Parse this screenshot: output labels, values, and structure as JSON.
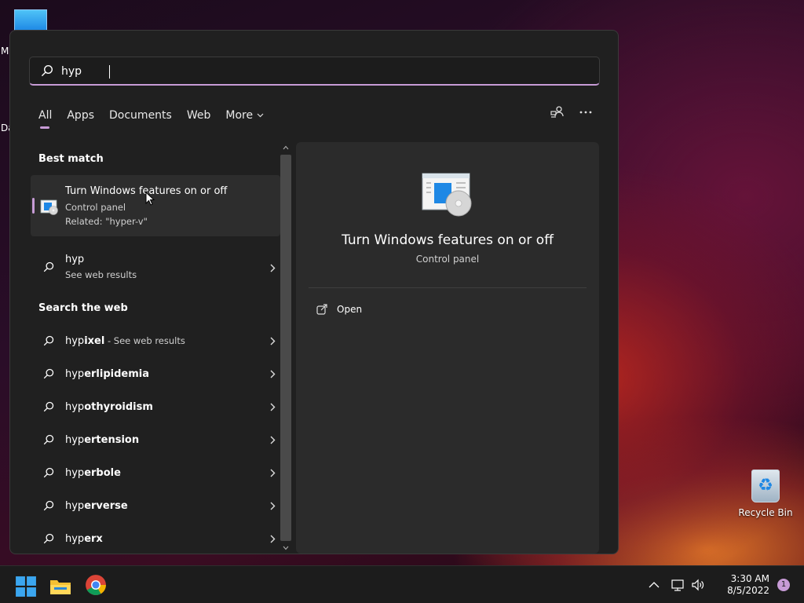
{
  "desktop": {
    "edge_labels": [
      "M",
      "Da"
    ],
    "recycle_bin_label": "Recycle Bin"
  },
  "search": {
    "query": "hyp",
    "placeholder": ""
  },
  "filter_tabs": [
    {
      "label": "All",
      "active": true
    },
    {
      "label": "Apps"
    },
    {
      "label": "Documents"
    },
    {
      "label": "Web"
    },
    {
      "label": "More"
    }
  ],
  "best_match": {
    "section_title": "Best match",
    "title": "Turn Windows features on or off",
    "category": "Control panel",
    "related": "Related: \"hyper-v\""
  },
  "web_result": {
    "query": "hyp",
    "subtitle": "See web results"
  },
  "search_web": {
    "section_title": "Search the web",
    "items": [
      {
        "prefix": "hyp",
        "suffix": "ixel",
        "note": " - See web results"
      },
      {
        "prefix": "hyp",
        "suffix": "erlipidemia",
        "note": ""
      },
      {
        "prefix": "hyp",
        "suffix": "othyroidism",
        "note": ""
      },
      {
        "prefix": "hyp",
        "suffix": "ertension",
        "note": ""
      },
      {
        "prefix": "hyp",
        "suffix": "erbole",
        "note": ""
      },
      {
        "prefix": "hyp",
        "suffix": "erverse",
        "note": ""
      },
      {
        "prefix": "hyp",
        "suffix": "erx",
        "note": ""
      }
    ]
  },
  "preview": {
    "title": "Turn Windows features on or off",
    "subtitle": "Control panel",
    "open_label": "Open"
  },
  "taskbar": {
    "time": "3:30 AM",
    "date": "8/5/2022",
    "notification_count": "1"
  },
  "colors": {
    "accent": "#c79bd6",
    "panel_bg": "#202020",
    "preview_bg": "#2b2b2b"
  }
}
